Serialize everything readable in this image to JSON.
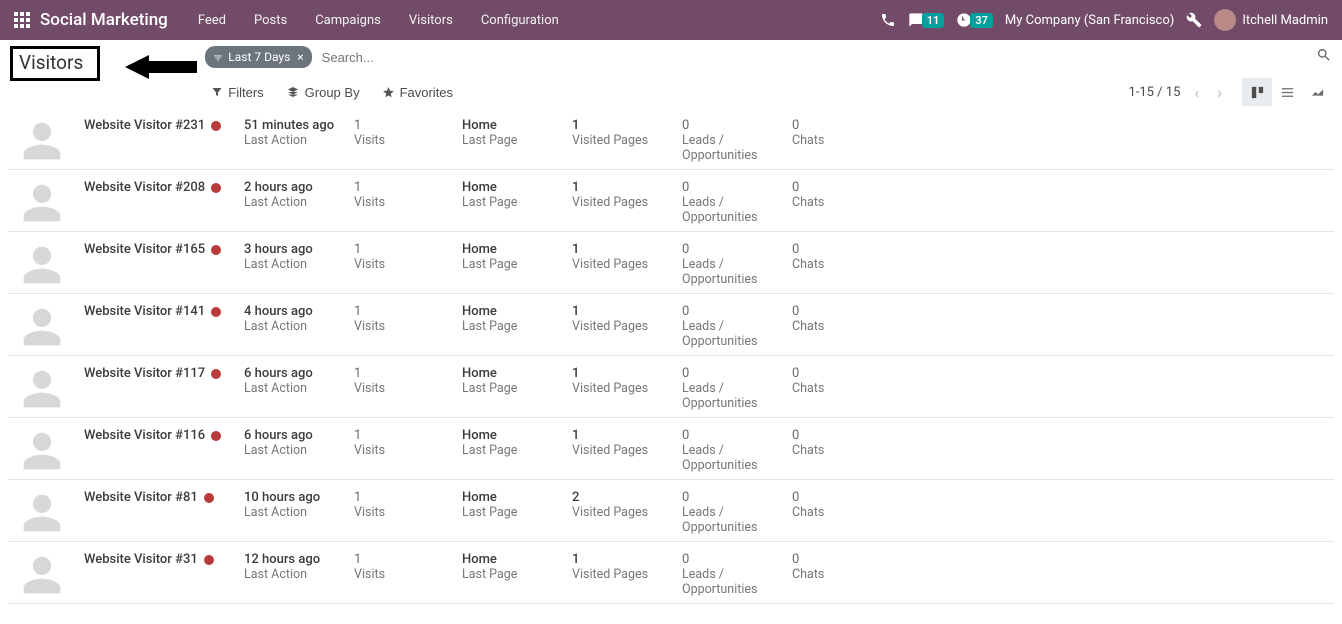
{
  "nav": {
    "brand": "Social Marketing",
    "items": [
      "Feed",
      "Posts",
      "Campaigns",
      "Visitors",
      "Configuration"
    ],
    "badge_discuss": "11",
    "badge_activities": "37",
    "company": "My Company (San Francisco)",
    "user_name": "Itchell Madmin"
  },
  "header": {
    "title": "Visitors",
    "search": {
      "placeholder": "Search...",
      "value": ""
    },
    "filter_tag": "Last 7 Days",
    "filters_btn": "Filters",
    "groupby_btn": "Group By",
    "favorites_btn": "Favorites",
    "pager": "1-15 / 15"
  },
  "labels": {
    "last_action": "Last Action",
    "visits": "Visits",
    "last_page": "Last Page",
    "visited_pages": "Visited Pages",
    "leads": "Leads / Opportunities",
    "chats": "Chats"
  },
  "rows": [
    {
      "name": "Website Visitor #231",
      "time": "51 minutes ago",
      "visits": "1",
      "last_page": "Home",
      "visited_pages": "1",
      "leads": "0",
      "chats": "0"
    },
    {
      "name": "Website Visitor #208",
      "time": "2 hours ago",
      "visits": "1",
      "last_page": "Home",
      "visited_pages": "1",
      "leads": "0",
      "chats": "0"
    },
    {
      "name": "Website Visitor #165",
      "time": "3 hours ago",
      "visits": "1",
      "last_page": "Home",
      "visited_pages": "1",
      "leads": "0",
      "chats": "0"
    },
    {
      "name": "Website Visitor #141",
      "time": "4 hours ago",
      "visits": "1",
      "last_page": "Home",
      "visited_pages": "1",
      "leads": "0",
      "chats": "0"
    },
    {
      "name": "Website Visitor #117",
      "time": "6 hours ago",
      "visits": "1",
      "last_page": "Home",
      "visited_pages": "1",
      "leads": "0",
      "chats": "0"
    },
    {
      "name": "Website Visitor #116",
      "time": "6 hours ago",
      "visits": "1",
      "last_page": "Home",
      "visited_pages": "1",
      "leads": "0",
      "chats": "0"
    },
    {
      "name": "Website Visitor #81",
      "time": "10 hours ago",
      "visits": "1",
      "last_page": "Home",
      "visited_pages": "2",
      "leads": "0",
      "chats": "0"
    },
    {
      "name": "Website Visitor #31",
      "time": "12 hours ago",
      "visits": "1",
      "last_page": "Home",
      "visited_pages": "1",
      "leads": "0",
      "chats": "0"
    }
  ]
}
